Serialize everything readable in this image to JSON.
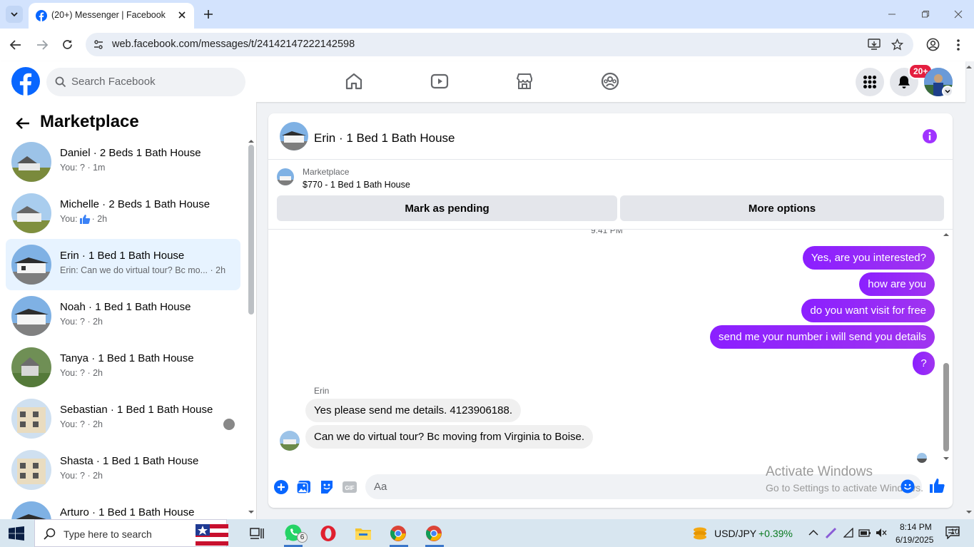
{
  "browser": {
    "tab_title": "(20+) Messenger | Facebook",
    "url": "web.facebook.com/messages/t/24142147222142598"
  },
  "header": {
    "search_placeholder": "Search Facebook",
    "notification_badge": "20+",
    "brand_color": "#0866ff"
  },
  "sidebar": {
    "title": "Marketplace",
    "conversations": [
      {
        "name": "Daniel · 2 Beds 1 Bath House",
        "preview": "You: ? · 1m",
        "selected": false
      },
      {
        "name": "Michelle · 2 Beds 1 Bath House",
        "preview_prefix": "You:",
        "preview_suffix": "· 2h",
        "selected": false
      },
      {
        "name": "Erin · 1 Bed 1 Bath House",
        "preview": "Erin: Can we do virtual tour? Bc mo... · 2h",
        "selected": true
      },
      {
        "name": "Noah · 1 Bed 1 Bath House",
        "preview": "You: ? · 2h",
        "selected": false
      },
      {
        "name": "Tanya · 1 Bed 1 Bath House",
        "preview": "You: ? · 2h",
        "selected": false
      },
      {
        "name": "Sebastian · 1 Bed 1 Bath House",
        "preview": "You: ? · 2h",
        "selected": false
      },
      {
        "name": "Shasta · 1 Bed 1 Bath House",
        "preview": "You: ? · 2h",
        "selected": false
      },
      {
        "name": "Arturo · 1 Bed 1 Bath House",
        "preview": "",
        "selected": false
      }
    ]
  },
  "chat": {
    "title": "Erin · 1 Bed 1 Bath House",
    "listing_label": "Marketplace",
    "listing_price": "$770 - 1 Bed 1 Bath House",
    "mark_pending_label": "Mark as pending",
    "more_options_label": "More options",
    "timestamp_partial": "9:41 PM",
    "outgoing": [
      "Yes, are you interested?",
      "how are you",
      "do you want visit for free",
      "send me your number i will send you details",
      "?"
    ],
    "sender_name": "Erin",
    "incoming": [
      "Yes please send me details. 4123906188.",
      "Can we do virtual tour? Bc moving from Virginia to Boise."
    ],
    "compose_placeholder": "Aa",
    "bubble_color": "#8b1fff"
  },
  "watermark": {
    "line1": "Activate Windows",
    "line2": "Go to Settings to activate Windows."
  },
  "taskbar": {
    "search_placeholder": "Type here to search",
    "whatsapp_badge": "6",
    "fx_pair": "USD/JPY",
    "fx_change": "+0.39%",
    "time": "8:14 PM",
    "date": "6/19/2025",
    "notification_count": "10"
  }
}
